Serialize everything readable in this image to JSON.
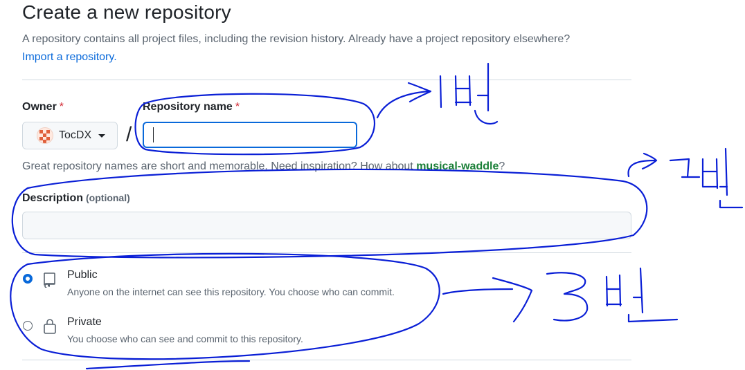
{
  "page": {
    "title": "Create a new repository",
    "subtitle": "A repository contains all project files, including the revision history. Already have a project repository elsewhere?",
    "import_link": "Import a repository."
  },
  "owner": {
    "label": "Owner",
    "required_mark": "*",
    "value": "TocDX"
  },
  "separator": "/",
  "repo_name": {
    "label": "Repository name",
    "required_mark": "*",
    "value": "",
    "placeholder": ""
  },
  "name_hint": {
    "text": "Great repository names are short and memorable. Need inspiration? How about",
    "suggestion": "musical-waddle",
    "end": "?"
  },
  "description": {
    "label": "Description",
    "optional": "(optional)",
    "value": "",
    "placeholder": ""
  },
  "visibility": {
    "options": [
      {
        "title": "Public",
        "description": "Anyone on the internet can see this repository. You choose who can commit.",
        "selected": true,
        "icon": "repo-book-icon"
      },
      {
        "title": "Private",
        "description": "You choose who can see and commit to this repository.",
        "selected": false,
        "icon": "lock-icon"
      }
    ]
  },
  "annotations": [
    "1번",
    "2번",
    "3번"
  ],
  "colors": {
    "accent": "#0969da",
    "link": "#0969da",
    "suggestion": "#1a7f37",
    "required": "#d1242f",
    "annotation_ink": "#0a1fd6"
  }
}
